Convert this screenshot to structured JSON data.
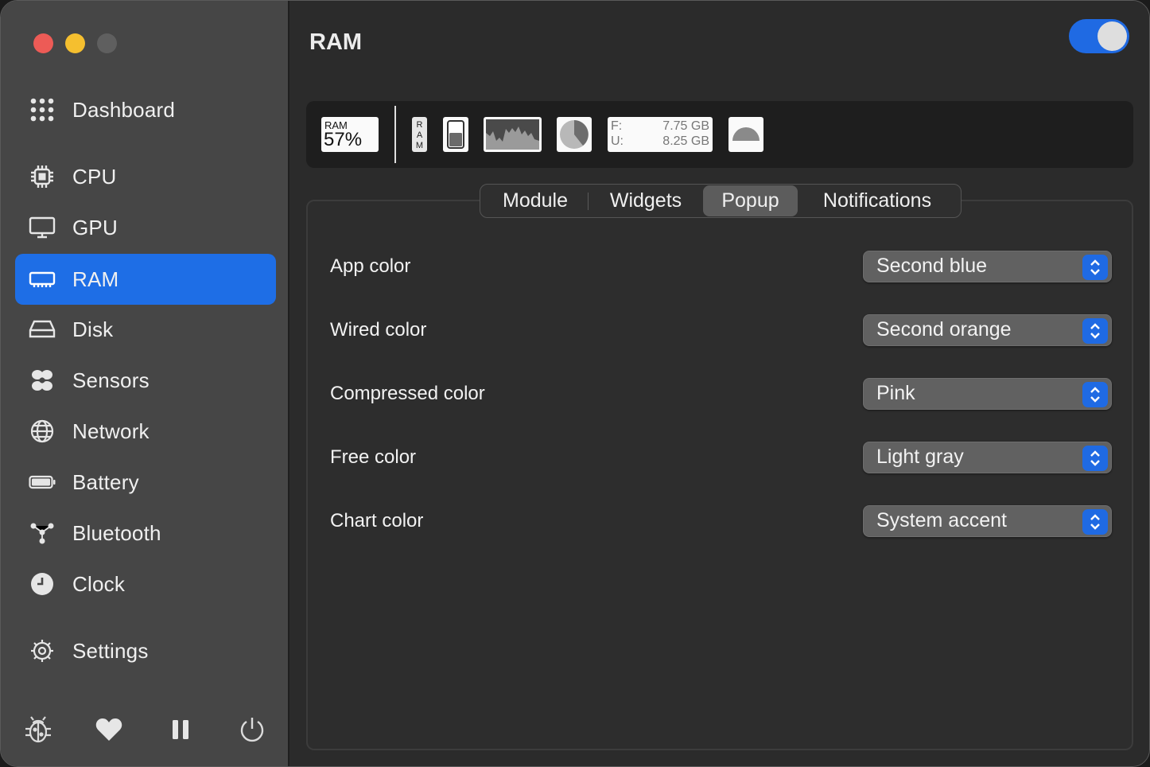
{
  "window": {
    "title": "RAM",
    "enabled": true
  },
  "sidebar": {
    "items": [
      {
        "label": "Dashboard",
        "icon": "dashboard-grid-icon"
      },
      {
        "label": "CPU",
        "icon": "cpu-chip-icon"
      },
      {
        "label": "GPU",
        "icon": "gpu-display-icon"
      },
      {
        "label": "RAM",
        "icon": "ram-module-icon",
        "active": true
      },
      {
        "label": "Disk",
        "icon": "disk-drive-icon"
      },
      {
        "label": "Sensors",
        "icon": "fan-icon"
      },
      {
        "label": "Network",
        "icon": "globe-icon"
      },
      {
        "label": "Battery",
        "icon": "battery-icon"
      },
      {
        "label": "Bluetooth",
        "icon": "bluetooth-network-icon"
      },
      {
        "label": "Clock",
        "icon": "clock-icon"
      },
      {
        "label": "Settings",
        "icon": "gear-icon"
      }
    ],
    "footer_icons": [
      "bug-icon",
      "heart-icon",
      "pause-icon",
      "power-icon"
    ]
  },
  "widgets": {
    "mini": {
      "label": "RAM",
      "value": "57%"
    },
    "label_widget": "RAM",
    "memory": {
      "free_label": "F:",
      "free_value": "7.75 GB",
      "used_label": "U:",
      "used_value": "8.25 GB"
    }
  },
  "tabs": [
    {
      "label": "Module"
    },
    {
      "label": "Widgets"
    },
    {
      "label": "Popup",
      "active": true
    },
    {
      "label": "Notifications"
    }
  ],
  "settings": [
    {
      "label": "App color",
      "value": "Second blue"
    },
    {
      "label": "Wired color",
      "value": "Second orange"
    },
    {
      "label": "Compressed color",
      "value": "Pink"
    },
    {
      "label": "Free color",
      "value": "Light gray"
    },
    {
      "label": "Chart color",
      "value": "System accent"
    }
  ],
  "colors": {
    "accent": "#1e6ee6",
    "sidebar_bg": "#464646",
    "main_bg": "#2b2b2b"
  }
}
